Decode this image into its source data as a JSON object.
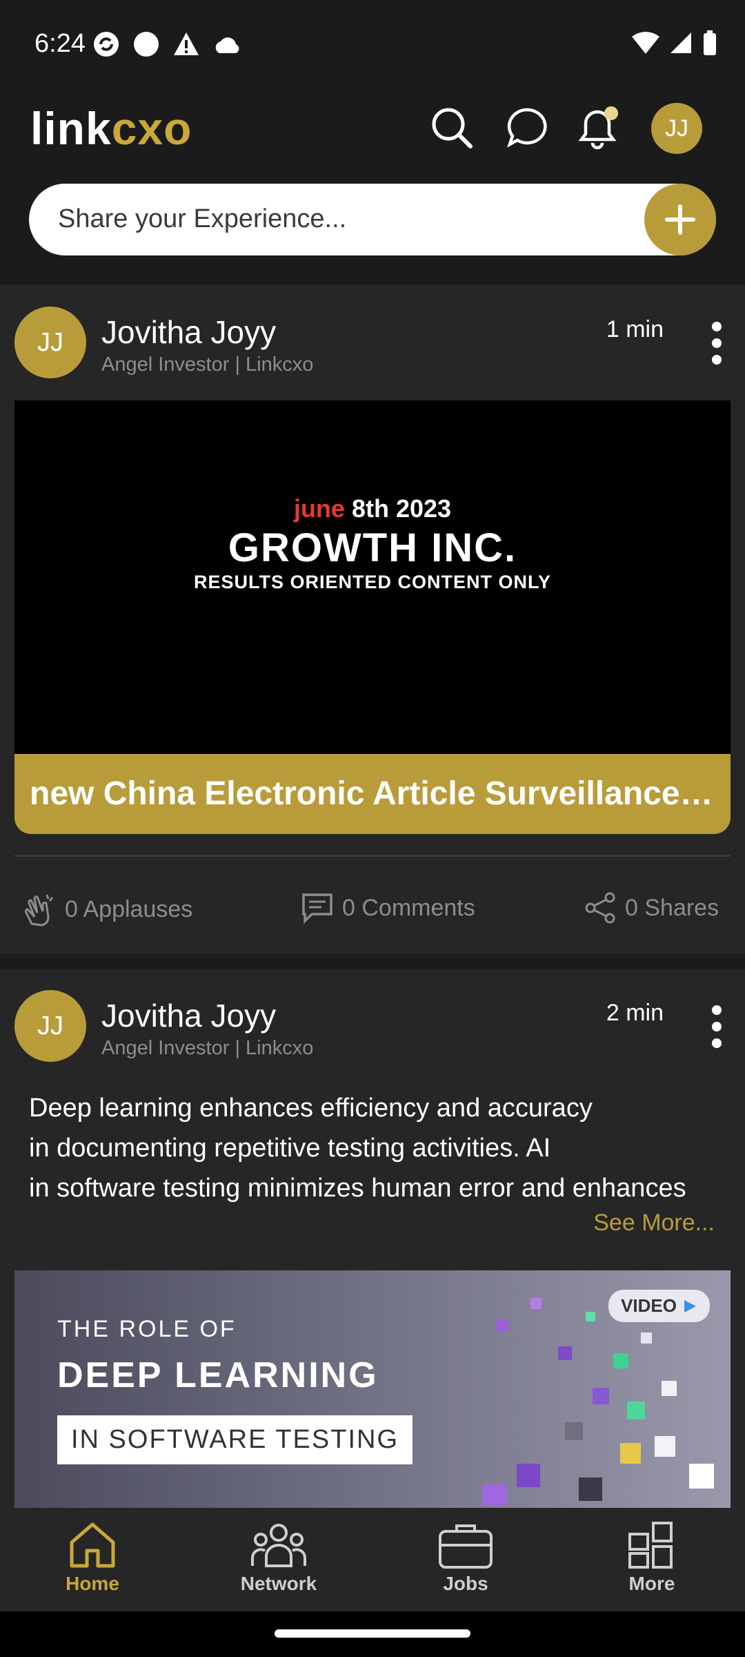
{
  "status_bar": {
    "time": "6:24"
  },
  "header": {
    "logo_white": "link",
    "logo_gold": "cxo",
    "avatar_initials": "JJ",
    "share_placeholder": "Share your Experience..."
  },
  "posts": [
    {
      "initials": "JJ",
      "author": "Jovitha Joyy",
      "subtitle": "Angel Investor | Linkcxo",
      "time": "1 min",
      "banner_red": "june",
      "banner_line1": "8th 2023",
      "banner_line2": "GROWTH INC.",
      "banner_line3": "RESULTS ORIENTED CONTENT ONLY",
      "caption": "new China Electronic Article Surveillance System",
      "applauses": "0 Applauses",
      "comments": "0 Comments",
      "shares": "0 Shares"
    },
    {
      "initials": "JJ",
      "author": "Jovitha Joyy",
      "subtitle": "Angel Investor | Linkcxo",
      "time": "2 min",
      "lines": [
        "Deep learning enhances efficiency and accuracy",
        "in documenting repetitive testing activities. AI",
        "in software testing minimizes human error and enhances"
      ],
      "see_more": "See More...",
      "image_line1": "THE ROLE OF",
      "image_line2": "DEEP LEARNING",
      "image_line3": "IN SOFTWARE TESTING",
      "video_badge": "VIDEO"
    }
  ],
  "nav": [
    {
      "label": "Home",
      "icon": "home-icon",
      "active": true
    },
    {
      "label": "Network",
      "icon": "network-icon"
    },
    {
      "label": "Jobs",
      "icon": "briefcase-icon"
    },
    {
      "label": "More",
      "icon": "grid-icon"
    }
  ],
  "colors": {
    "accent": "#b99c3a",
    "background": "#1b1b1b",
    "card": "#262626"
  }
}
